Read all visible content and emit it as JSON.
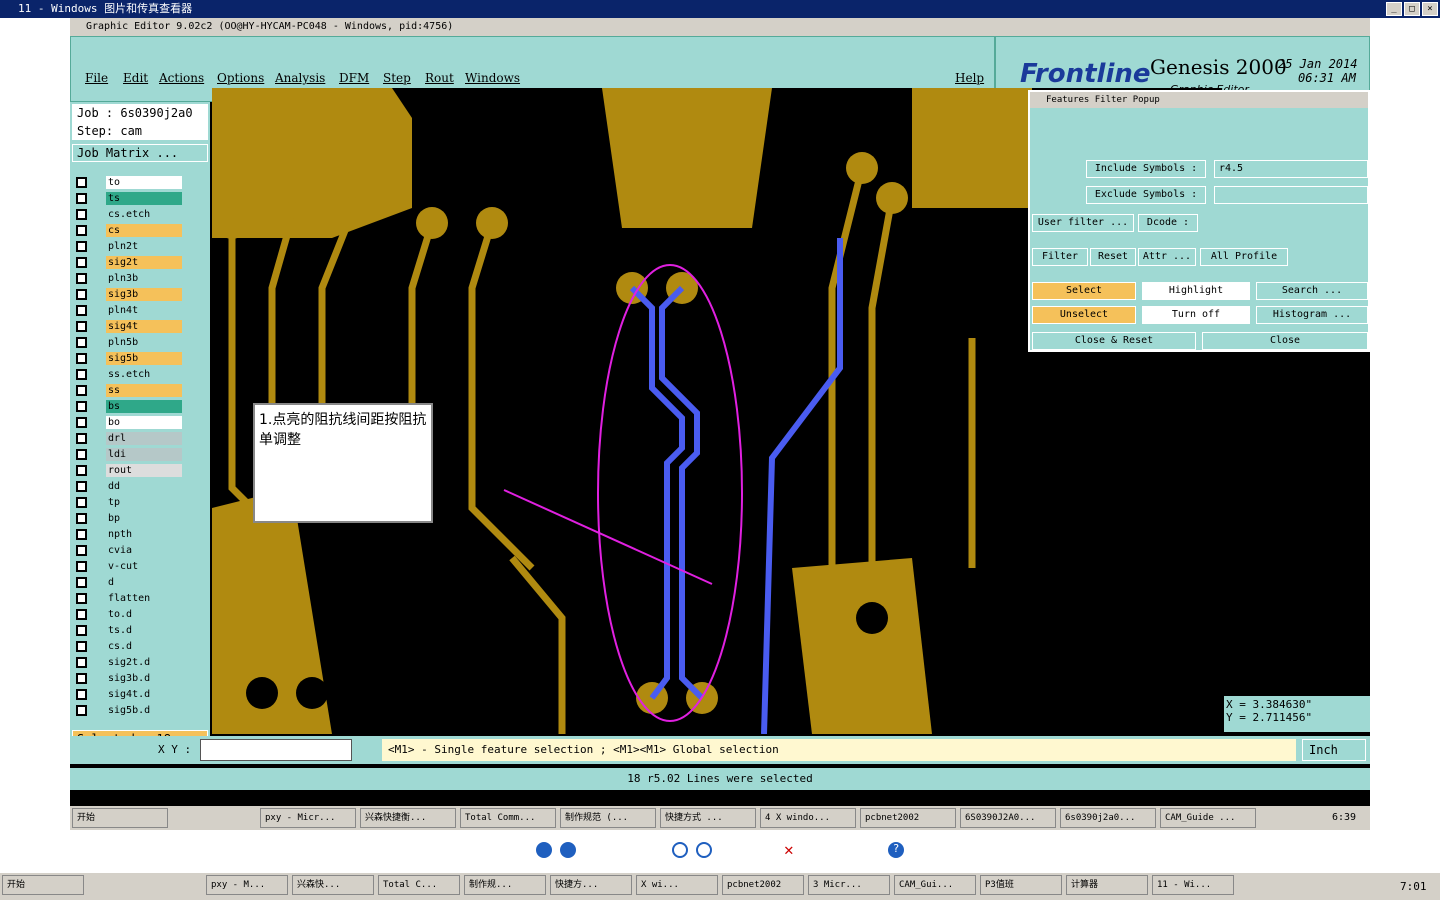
{
  "outer_title": "11 - Windows 图片和传真查看器",
  "app_title": "Graphic Editor 9.02c2 (OO@HY-HYCAM-PC048 - Windows, pid:4756)",
  "menu": [
    "File",
    "Edit",
    "Actions",
    "Options",
    "Analysis",
    "DFM",
    "Step",
    "Rout",
    "Windows"
  ],
  "help": "Help",
  "brand": {
    "logo": "Frontline",
    "product": "Genesis 2000",
    "sub": "Graphic Editor",
    "date": "25 Jan 2014",
    "time": "06:31 AM"
  },
  "job": "Job : 6s0390j2a0",
  "step": "Step: cam",
  "job_matrix": "Job Matrix ...",
  "layers": [
    "to",
    "ts",
    "cs.etch",
    "cs",
    "pln2t",
    "sig2t",
    "pln3b",
    "sig3b",
    "pln4t",
    "sig4t",
    "pln5b",
    "sig5b",
    "ss.etch",
    "ss",
    "bs",
    "bo",
    "drl",
    "ldi",
    "rout",
    "dd",
    "tp",
    "bp",
    "npth",
    "cvia",
    "v-cut",
    "d",
    "flatten",
    "to.d",
    "ts.d",
    "cs.d",
    "sig2t.d",
    "sig3b.d",
    "sig4t.d",
    "sig5b.d"
  ],
  "selected": "Selected : 18",
  "popup": {
    "title": "Features Filter Popup",
    "include": "Include Symbols :",
    "include_val": "r4.5",
    "exclude": "Exclude Symbols :",
    "user_filter": "User filter ...",
    "dcode": "Dcode :",
    "filter": "Filter",
    "reset": "Reset",
    "attr": "Attr ...",
    "all_profile": "All Profile",
    "select": "Select",
    "highlight": "Highlight",
    "search": "Search ...",
    "unselect": "Unselect",
    "turn_off": "Turn off",
    "histogram": "Histogram ...",
    "close_reset": "Close & Reset",
    "close": "Close"
  },
  "coords": {
    "x": "X = 3.384630\"",
    "y": "Y = 2.711456\""
  },
  "xy_label": "X Y :",
  "hint": "<M1> - Single feature selection ; <M1><M1> Global selection",
  "unit": "Inch",
  "status": "18 r5.02 Lines were selected",
  "note": "1.点亮的阻抗线间距按阻抗单调整",
  "inner_tasks": [
    "开始",
    "pxy - Micr...",
    "兴森快捷衡...",
    "Total Comm...",
    "制作规范 (...",
    "快捷方式 ...",
    "4 X windo...",
    "pcbnet2002",
    "6S0390J2A0...",
    "6s0390j2a0...",
    "CAM_Guide ..."
  ],
  "inner_time": "6:39",
  "outer_tasks": [
    "开始",
    "pxy - M...",
    "兴森快...",
    "Total C...",
    "制作规...",
    "快捷方...",
    "X wi...",
    "pcbnet2002",
    "3 Micr...",
    "CAM_Gui...",
    "P3值班",
    "计算器",
    "11 - Wi..."
  ],
  "outer_time": "7:01"
}
